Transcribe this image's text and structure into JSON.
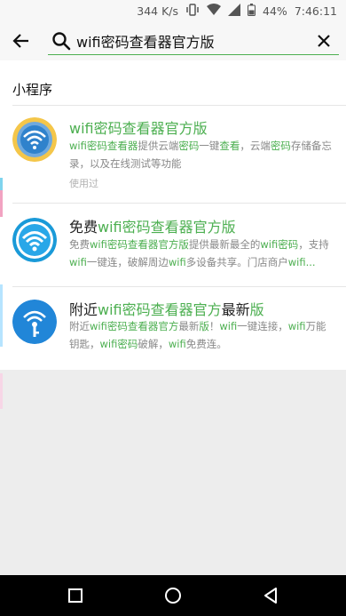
{
  "status_bar": {
    "speed": "344 K/s",
    "battery": "44%",
    "time": "7:46:11",
    "icons": [
      "vibrate-icon",
      "wifi-icon",
      "signal-icon",
      "battery-icon"
    ]
  },
  "search": {
    "query": "wifi密码查看器官方版",
    "accent": "#4caf50"
  },
  "section": {
    "title": "小程序"
  },
  "results": [
    {
      "title": [
        [
          "wifi密码查看器官方版",
          true
        ]
      ],
      "desc": [
        [
          "wifi密码查看器",
          true
        ],
        [
          "提供云端",
          false
        ],
        [
          "密码",
          true
        ],
        [
          "一键",
          false
        ],
        [
          "查看",
          true
        ],
        [
          "，云端",
          false
        ],
        [
          "密码",
          true
        ],
        [
          "存储备忘录，以及在线测试等功能",
          false
        ]
      ],
      "meta": "使用过",
      "icon": "wifi-lens-icon"
    },
    {
      "title": [
        [
          "免费",
          false
        ],
        [
          "wifi密码查看器官方版",
          true
        ]
      ],
      "desc": [
        [
          "免费",
          false
        ],
        [
          "wifi密码查看器官方版",
          true
        ],
        [
          "提供最新最全的",
          false
        ],
        [
          "wifi密码",
          true
        ],
        [
          "，支持",
          false
        ],
        [
          "wifi",
          true
        ],
        [
          "一键连，破解周边",
          false
        ],
        [
          "wifi",
          true
        ],
        [
          "多设备共享。门店商户",
          false
        ],
        [
          "wifi...",
          true
        ]
      ],
      "meta": "",
      "icon": "wifi-circle-icon"
    },
    {
      "title": [
        [
          "附近",
          false
        ],
        [
          "wifi密码查看器官方",
          true
        ],
        [
          "最新",
          false
        ],
        [
          "版",
          true
        ]
      ],
      "desc": [
        [
          "附近",
          false
        ],
        [
          "wifi密码查看器官方",
          true
        ],
        [
          "最新",
          false
        ],
        [
          "版",
          true
        ],
        [
          "！",
          false
        ],
        [
          "wifi",
          true
        ],
        [
          "一键连接，",
          false
        ],
        [
          "wifi",
          true
        ],
        [
          "万能钥匙，",
          false
        ],
        [
          "wifi密码",
          true
        ],
        [
          "破解，",
          false
        ],
        [
          "wifi",
          true
        ],
        [
          "免费连。",
          false
        ]
      ],
      "meta": "",
      "icon": "wifi-key-icon"
    }
  ]
}
